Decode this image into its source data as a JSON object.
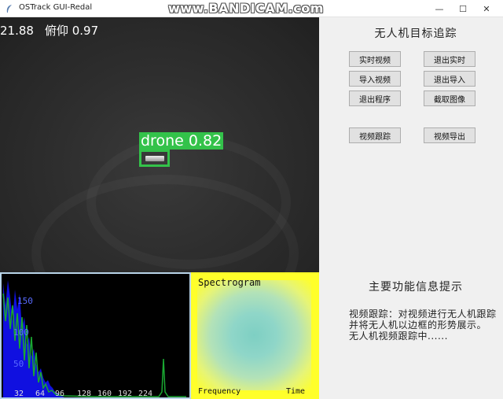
{
  "window": {
    "title": "OSTrack GUI-Redal",
    "watermark": "www.BANDICAM.com",
    "controls": {
      "minimize": "—",
      "maximize": "☐",
      "close": "✕"
    }
  },
  "video": {
    "hud_yaw": "21.88",
    "hud_pitch": "俯仰 0.97",
    "detection_label": "drone 0.82"
  },
  "panel": {
    "title": "无人机目标追踪",
    "buttons": {
      "realtime_video": "实时视频",
      "exit_realtime": "退出实时",
      "import_video": "导入视频",
      "exit_import": "退出导入",
      "exit_program": "退出程序",
      "capture_image": "截取图像",
      "video_tracking": "视频跟踪",
      "video_export": "视频导出"
    }
  },
  "info": {
    "title": "主要功能信息提示",
    "lines": [
      "视频跟踪：对视频进行无人机跟踪",
      "并将无人机以边框的形势展示。",
      "无人机视频跟踪中......"
    ]
  },
  "histogram": {
    "y_ticks": [
      "150",
      "100",
      "50"
    ],
    "x_ticks": [
      "32",
      "64",
      "96",
      "128",
      "160",
      "192",
      "224"
    ],
    "colors": {
      "fill": "#1010e0",
      "line": "#1aa832"
    }
  },
  "spectrogram": {
    "title": "Spectrogram",
    "xlabel": "Frequency",
    "ylabel": "Time",
    "colors": {
      "background": "#ffff2a",
      "core": "#8fd6c8"
    }
  }
}
